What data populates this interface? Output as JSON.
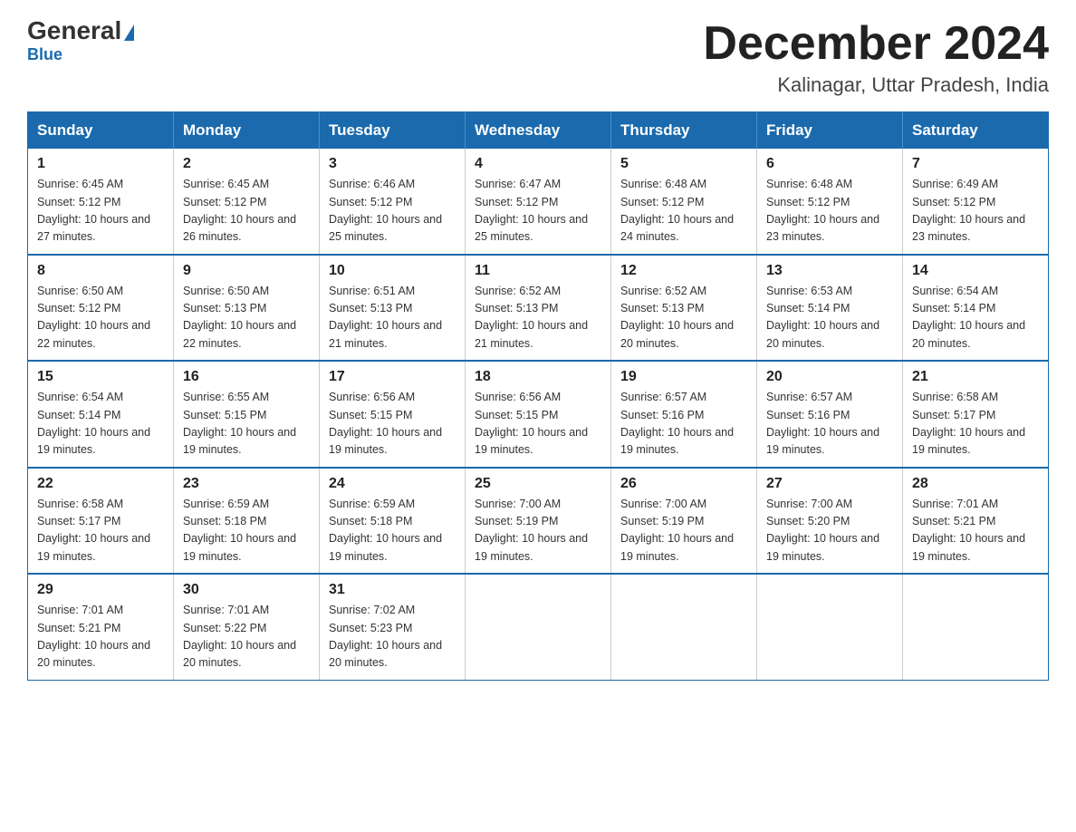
{
  "logo": {
    "general": "General",
    "blue": "Blue",
    "tagline": "Blue"
  },
  "header": {
    "month_year": "December 2024",
    "location": "Kalinagar, Uttar Pradesh, India"
  },
  "days_of_week": [
    "Sunday",
    "Monday",
    "Tuesday",
    "Wednesday",
    "Thursday",
    "Friday",
    "Saturday"
  ],
  "weeks": [
    [
      {
        "day": "1",
        "sunrise": "Sunrise: 6:45 AM",
        "sunset": "Sunset: 5:12 PM",
        "daylight": "Daylight: 10 hours and 27 minutes."
      },
      {
        "day": "2",
        "sunrise": "Sunrise: 6:45 AM",
        "sunset": "Sunset: 5:12 PM",
        "daylight": "Daylight: 10 hours and 26 minutes."
      },
      {
        "day": "3",
        "sunrise": "Sunrise: 6:46 AM",
        "sunset": "Sunset: 5:12 PM",
        "daylight": "Daylight: 10 hours and 25 minutes."
      },
      {
        "day": "4",
        "sunrise": "Sunrise: 6:47 AM",
        "sunset": "Sunset: 5:12 PM",
        "daylight": "Daylight: 10 hours and 25 minutes."
      },
      {
        "day": "5",
        "sunrise": "Sunrise: 6:48 AM",
        "sunset": "Sunset: 5:12 PM",
        "daylight": "Daylight: 10 hours and 24 minutes."
      },
      {
        "day": "6",
        "sunrise": "Sunrise: 6:48 AM",
        "sunset": "Sunset: 5:12 PM",
        "daylight": "Daylight: 10 hours and 23 minutes."
      },
      {
        "day": "7",
        "sunrise": "Sunrise: 6:49 AM",
        "sunset": "Sunset: 5:12 PM",
        "daylight": "Daylight: 10 hours and 23 minutes."
      }
    ],
    [
      {
        "day": "8",
        "sunrise": "Sunrise: 6:50 AM",
        "sunset": "Sunset: 5:12 PM",
        "daylight": "Daylight: 10 hours and 22 minutes."
      },
      {
        "day": "9",
        "sunrise": "Sunrise: 6:50 AM",
        "sunset": "Sunset: 5:13 PM",
        "daylight": "Daylight: 10 hours and 22 minutes."
      },
      {
        "day": "10",
        "sunrise": "Sunrise: 6:51 AM",
        "sunset": "Sunset: 5:13 PM",
        "daylight": "Daylight: 10 hours and 21 minutes."
      },
      {
        "day": "11",
        "sunrise": "Sunrise: 6:52 AM",
        "sunset": "Sunset: 5:13 PM",
        "daylight": "Daylight: 10 hours and 21 minutes."
      },
      {
        "day": "12",
        "sunrise": "Sunrise: 6:52 AM",
        "sunset": "Sunset: 5:13 PM",
        "daylight": "Daylight: 10 hours and 20 minutes."
      },
      {
        "day": "13",
        "sunrise": "Sunrise: 6:53 AM",
        "sunset": "Sunset: 5:14 PM",
        "daylight": "Daylight: 10 hours and 20 minutes."
      },
      {
        "day": "14",
        "sunrise": "Sunrise: 6:54 AM",
        "sunset": "Sunset: 5:14 PM",
        "daylight": "Daylight: 10 hours and 20 minutes."
      }
    ],
    [
      {
        "day": "15",
        "sunrise": "Sunrise: 6:54 AM",
        "sunset": "Sunset: 5:14 PM",
        "daylight": "Daylight: 10 hours and 19 minutes."
      },
      {
        "day": "16",
        "sunrise": "Sunrise: 6:55 AM",
        "sunset": "Sunset: 5:15 PM",
        "daylight": "Daylight: 10 hours and 19 minutes."
      },
      {
        "day": "17",
        "sunrise": "Sunrise: 6:56 AM",
        "sunset": "Sunset: 5:15 PM",
        "daylight": "Daylight: 10 hours and 19 minutes."
      },
      {
        "day": "18",
        "sunrise": "Sunrise: 6:56 AM",
        "sunset": "Sunset: 5:15 PM",
        "daylight": "Daylight: 10 hours and 19 minutes."
      },
      {
        "day": "19",
        "sunrise": "Sunrise: 6:57 AM",
        "sunset": "Sunset: 5:16 PM",
        "daylight": "Daylight: 10 hours and 19 minutes."
      },
      {
        "day": "20",
        "sunrise": "Sunrise: 6:57 AM",
        "sunset": "Sunset: 5:16 PM",
        "daylight": "Daylight: 10 hours and 19 minutes."
      },
      {
        "day": "21",
        "sunrise": "Sunrise: 6:58 AM",
        "sunset": "Sunset: 5:17 PM",
        "daylight": "Daylight: 10 hours and 19 minutes."
      }
    ],
    [
      {
        "day": "22",
        "sunrise": "Sunrise: 6:58 AM",
        "sunset": "Sunset: 5:17 PM",
        "daylight": "Daylight: 10 hours and 19 minutes."
      },
      {
        "day": "23",
        "sunrise": "Sunrise: 6:59 AM",
        "sunset": "Sunset: 5:18 PM",
        "daylight": "Daylight: 10 hours and 19 minutes."
      },
      {
        "day": "24",
        "sunrise": "Sunrise: 6:59 AM",
        "sunset": "Sunset: 5:18 PM",
        "daylight": "Daylight: 10 hours and 19 minutes."
      },
      {
        "day": "25",
        "sunrise": "Sunrise: 7:00 AM",
        "sunset": "Sunset: 5:19 PM",
        "daylight": "Daylight: 10 hours and 19 minutes."
      },
      {
        "day": "26",
        "sunrise": "Sunrise: 7:00 AM",
        "sunset": "Sunset: 5:19 PM",
        "daylight": "Daylight: 10 hours and 19 minutes."
      },
      {
        "day": "27",
        "sunrise": "Sunrise: 7:00 AM",
        "sunset": "Sunset: 5:20 PM",
        "daylight": "Daylight: 10 hours and 19 minutes."
      },
      {
        "day": "28",
        "sunrise": "Sunrise: 7:01 AM",
        "sunset": "Sunset: 5:21 PM",
        "daylight": "Daylight: 10 hours and 19 minutes."
      }
    ],
    [
      {
        "day": "29",
        "sunrise": "Sunrise: 7:01 AM",
        "sunset": "Sunset: 5:21 PM",
        "daylight": "Daylight: 10 hours and 20 minutes."
      },
      {
        "day": "30",
        "sunrise": "Sunrise: 7:01 AM",
        "sunset": "Sunset: 5:22 PM",
        "daylight": "Daylight: 10 hours and 20 minutes."
      },
      {
        "day": "31",
        "sunrise": "Sunrise: 7:02 AM",
        "sunset": "Sunset: 5:23 PM",
        "daylight": "Daylight: 10 hours and 20 minutes."
      },
      null,
      null,
      null,
      null
    ]
  ]
}
